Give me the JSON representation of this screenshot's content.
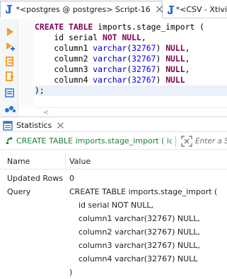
{
  "editor_tabs": [
    {
      "label": "*<postgres @ postgres> Script-16",
      "active": true
    },
    {
      "label": "*<CSV - Xtivi",
      "active": false
    }
  ],
  "code_lines": [
    {
      "parts": [
        {
          "t": "CREATE TABLE",
          "k": "kw"
        },
        {
          "t": " imports.stage_import (",
          "k": ""
        }
      ]
    },
    {
      "parts": [
        {
          "t": "    id serial ",
          "k": ""
        },
        {
          "t": "NOT NULL",
          "k": "kw"
        },
        {
          "t": ",",
          "k": ""
        }
      ]
    },
    {
      "parts": [
        {
          "t": "    column1 ",
          "k": ""
        },
        {
          "t": "varchar",
          "k": "fn"
        },
        {
          "t": "(",
          "k": ""
        },
        {
          "t": "32767",
          "k": "num"
        },
        {
          "t": ") ",
          "k": ""
        },
        {
          "t": "NULL",
          "k": "kw"
        },
        {
          "t": ",",
          "k": ""
        }
      ]
    },
    {
      "parts": [
        {
          "t": "    column2 ",
          "k": ""
        },
        {
          "t": "varchar",
          "k": "fn"
        },
        {
          "t": "(",
          "k": ""
        },
        {
          "t": "32767",
          "k": "num"
        },
        {
          "t": ") ",
          "k": ""
        },
        {
          "t": "NULL",
          "k": "kw"
        },
        {
          "t": ",",
          "k": ""
        }
      ]
    },
    {
      "parts": [
        {
          "t": "    column3 ",
          "k": ""
        },
        {
          "t": "varchar",
          "k": "fn"
        },
        {
          "t": "(",
          "k": ""
        },
        {
          "t": "32767",
          "k": "num"
        },
        {
          "t": ") ",
          "k": ""
        },
        {
          "t": "NULL",
          "k": "kw"
        },
        {
          "t": ",",
          "k": ""
        }
      ]
    },
    {
      "parts": [
        {
          "t": "    column4 ",
          "k": ""
        },
        {
          "t": "varchar",
          "k": "fn"
        },
        {
          "t": "(",
          "k": ""
        },
        {
          "t": "32767",
          "k": "num"
        },
        {
          "t": ") ",
          "k": ""
        },
        {
          "t": "NULL",
          "k": "kw"
        }
      ]
    },
    {
      "parts": [
        {
          "t": ");",
          "k": ""
        }
      ]
    }
  ],
  "editor_toolbar_icons": [
    "execute-statement-icon",
    "execute-script-icon",
    "explain-plan-icon",
    "load-plan-icon",
    "export-icon",
    "toggle-panels-icon"
  ],
  "statistics": {
    "tab_label": "Statistics",
    "query_text": "CREATE TABLE imports.stage_import ( id s",
    "filter_placeholder": "Enter a S",
    "columns": [
      "Name",
      "Value"
    ],
    "rows": [
      {
        "name": "Updated Rows",
        "value": "0"
      },
      {
        "name": "Query",
        "value": "CREATE TABLE imports.stage_import ("
      }
    ],
    "query_continuation": [
      "id serial NOT NULL,",
      "column1 varchar(32767) NULL,",
      "column2 varchar(32767) NULL,",
      "column3 varchar(32767) NULL,",
      "column4 varchar(32767) NULL",
      ")"
    ]
  },
  "colors": {
    "keyword": "#7f0055",
    "function": "#0000c0",
    "number": "#0000ff",
    "query_link": "#1e7d3e",
    "tool_orange": "#f0a030"
  }
}
